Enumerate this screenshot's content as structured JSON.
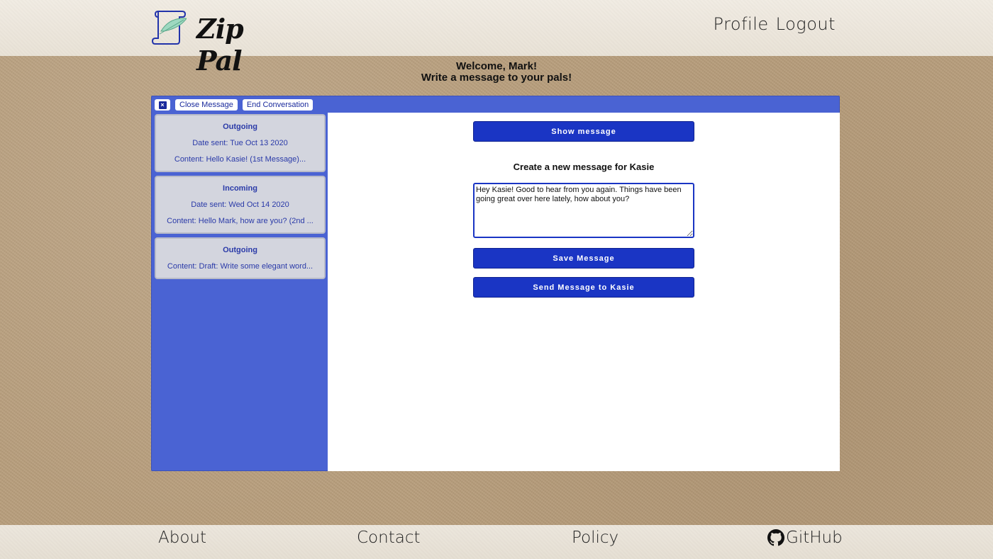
{
  "app": {
    "name": "Zip Pal"
  },
  "header": {
    "nav": [
      {
        "label": "Profile"
      },
      {
        "label": "Logout"
      }
    ]
  },
  "welcome": {
    "line1": "Welcome, Mark!",
    "line2": "Write a message to your pals!"
  },
  "toolbar": {
    "close_icon": "×",
    "close_message_label": "Close Message",
    "end_conversation_label": "End Conversation"
  },
  "messages": [
    {
      "direction": "Outgoing",
      "date": "Date sent: Tue Oct 13 2020",
      "content": "Content: Hello Kasie! (1st Message)..."
    },
    {
      "direction": "Incoming",
      "date": "Date sent: Wed Oct 14 2020",
      "content": "Content: Hello Mark, how are you? (2nd ..."
    },
    {
      "direction": "Outgoing",
      "content": "Content: Draft: Write some elegant word..."
    }
  ],
  "composer": {
    "show_message_label": "Show message",
    "title": "Create a new message for Kasie",
    "text": "Hey Kasie! Good to hear from you again. Things have been going great over here lately, how about you?",
    "save_label": "Save Message",
    "send_label": "Send Message to Kasie"
  },
  "footer": {
    "about": "About",
    "contact": "Contact",
    "policy": "Policy",
    "github": "GitHub"
  },
  "colors": {
    "accent": "#1a35c4",
    "panel": "#4a63d3",
    "card": "#d3d5de"
  }
}
